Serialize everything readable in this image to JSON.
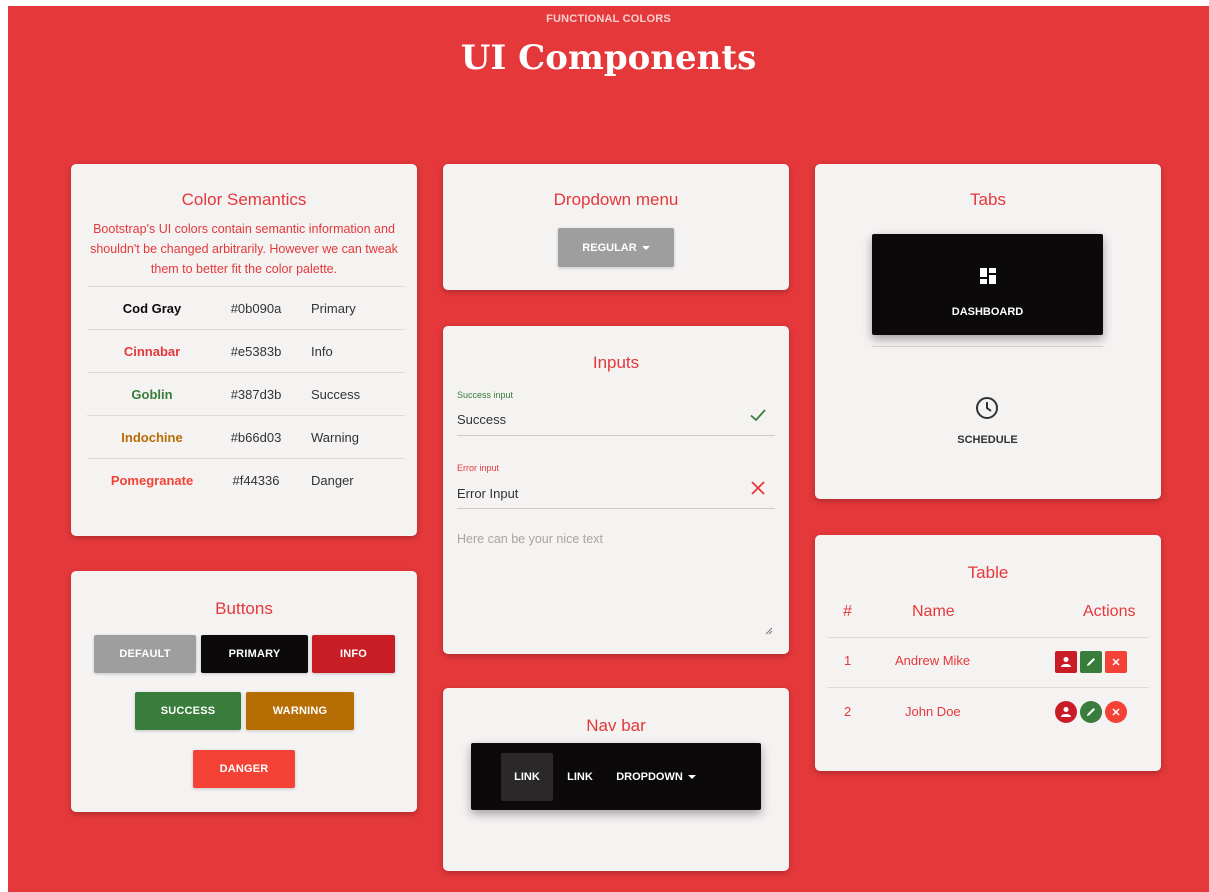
{
  "header": {
    "eyebrow": "FUNCTIONAL COLORS",
    "title": "UI Components"
  },
  "color_semantics": {
    "title": "Color Semantics",
    "description": "Bootstrap's UI colors contain semantic information and shouldn't be changed arbitrarily. However we can tweak them to better fit the color palette.",
    "rows": [
      {
        "name": "Cod Gray",
        "hex": "#0b090a",
        "role": "Primary",
        "color": "#0b090a"
      },
      {
        "name": "Cinnabar",
        "hex": "#e5383b",
        "role": "Info",
        "color": "#e5383b"
      },
      {
        "name": "Goblin",
        "hex": "#387d3b",
        "role": "Success",
        "color": "#387d3b"
      },
      {
        "name": "Indochine",
        "hex": "#b66d03",
        "role": "Warning",
        "color": "#b66d03"
      },
      {
        "name": "Pomegranate",
        "hex": "#f44336",
        "role": "Danger",
        "color": "#f44336"
      }
    ]
  },
  "buttons": {
    "title": "Buttons",
    "default": "DEFAULT",
    "primary": "PRIMARY",
    "info": "INFO",
    "success": "SUCCESS",
    "warning": "WARNING",
    "danger": "DANGER"
  },
  "dropdown": {
    "title": "Dropdown menu",
    "label": "REGULAR"
  },
  "inputs": {
    "title": "Inputs",
    "success_label": "Success input",
    "success_value": "Success",
    "error_label": "Error input",
    "error_value": "Error Input",
    "textarea_placeholder": "Here can be your nice text"
  },
  "navbar": {
    "title": "Nav bar",
    "items": [
      "LINK",
      "LINK",
      "DROPDOWN"
    ]
  },
  "tabs": {
    "title": "Tabs",
    "items": [
      {
        "label": "DASHBOARD",
        "icon": "dashboard-icon",
        "active": true
      },
      {
        "label": "SCHEDULE",
        "icon": "clock-icon",
        "active": false
      }
    ]
  },
  "table": {
    "title": "Table",
    "headers": [
      "#",
      "Name",
      "Actions"
    ],
    "rows": [
      {
        "id": "1",
        "name": "Andrew Mike"
      },
      {
        "id": "2",
        "name": "John Doe"
      }
    ]
  },
  "colors": {
    "background": "#e5383b",
    "card": "#f5f2f2",
    "default": "#9e9e9e",
    "primary": "#0b090a",
    "info": "#c81d25",
    "success": "#387d3b",
    "warning": "#b66d03",
    "danger": "#f44336"
  }
}
